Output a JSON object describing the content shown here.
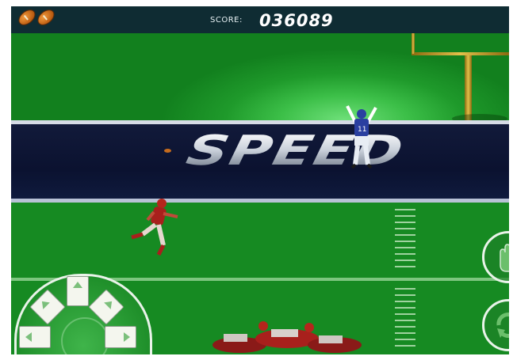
{
  "hud": {
    "lives": 2,
    "score_label": "SCORE:",
    "score_value": "036089"
  },
  "banner": {
    "text": "SPEED"
  },
  "controls": {
    "dpad_buttons": [
      "up",
      "up-left",
      "up-right",
      "left",
      "right"
    ],
    "action_buttons": [
      "stiff-arm",
      "spin"
    ]
  },
  "colors": {
    "field": "#137d1d",
    "hud_bar": "#0f2c33",
    "banner": "#0b1230",
    "home_jersey": "#2a3fa0",
    "away_jersey": "#a8201c"
  }
}
